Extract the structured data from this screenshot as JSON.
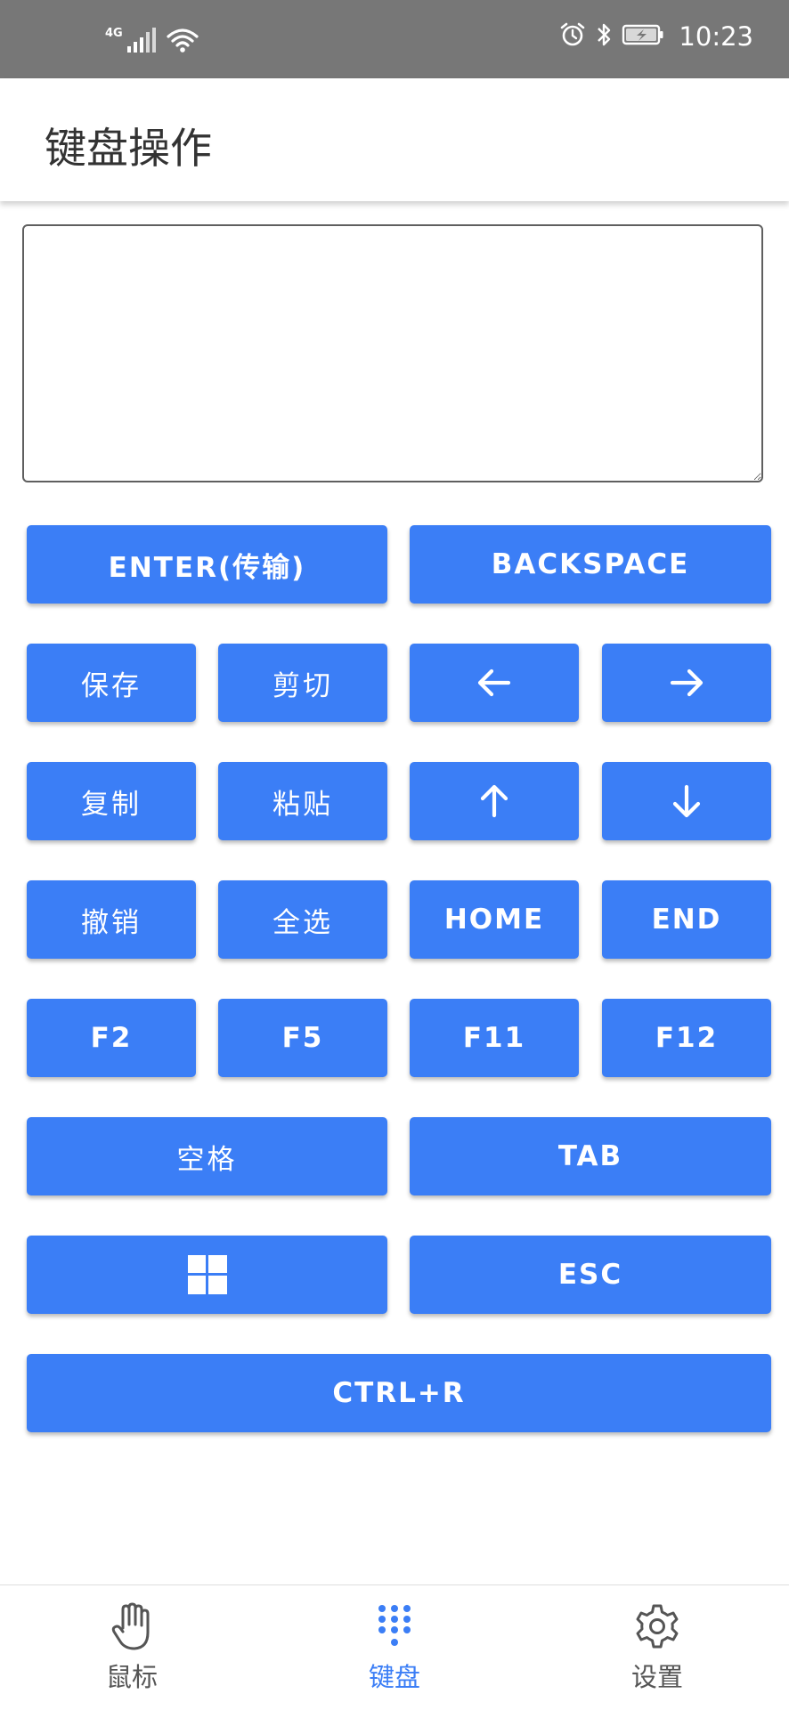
{
  "status_bar": {
    "network": "4G",
    "time": "10:23",
    "icons": [
      "signal-icon",
      "wifi-icon",
      "alarm-icon",
      "bluetooth-icon",
      "battery-icon"
    ]
  },
  "header": {
    "title": "键盘操作"
  },
  "input": {
    "value": "",
    "placeholder": ""
  },
  "keys": {
    "enter": "ENTER(传输)",
    "backspace": "BACKSPACE",
    "save": "保存",
    "cut": "剪切",
    "arrow_left_icon": "arrow-left-icon",
    "arrow_right_icon": "arrow-right-icon",
    "copy": "复制",
    "paste": "粘贴",
    "arrow_up_icon": "arrow-up-icon",
    "arrow_down_icon": "arrow-down-icon",
    "undo": "撤销",
    "select_all": "全选",
    "home": "HOME",
    "end": "END",
    "f2": "F2",
    "f5": "F5",
    "f11": "F11",
    "f12": "F12",
    "space": "空格",
    "tab": "TAB",
    "windows_icon": "windows-icon",
    "esc": "ESC",
    "ctrl_r": "CTRL+R"
  },
  "bottom_nav": {
    "items": [
      {
        "label": "鼠标",
        "icon": "hand-icon",
        "active": false
      },
      {
        "label": "键盘",
        "icon": "keypad-icon",
        "active": true
      },
      {
        "label": "设置",
        "icon": "gear-icon",
        "active": false
      }
    ]
  },
  "colors": {
    "accent": "#3b7ef6",
    "status_bar": "#777777",
    "nav_inactive": "#555555"
  }
}
